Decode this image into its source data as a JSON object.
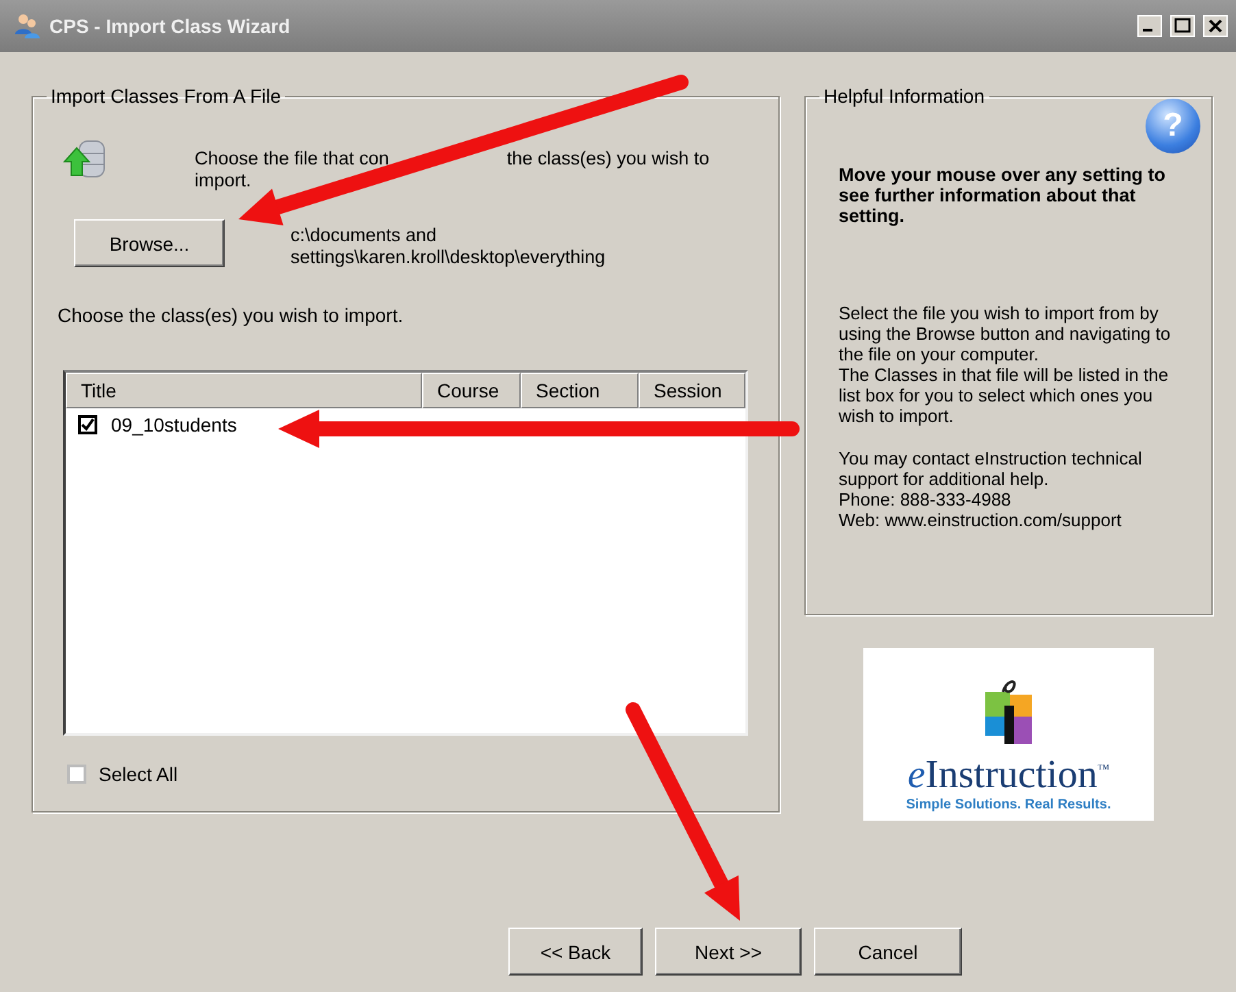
{
  "window": {
    "title": "CPS - Import Class Wizard"
  },
  "import_group": {
    "title": "Import Classes From A File",
    "instruction_parts": [
      "Choose the file that con",
      "the class(es) you wish to",
      "import."
    ],
    "browse_button": "Browse...",
    "file_path": "c:\\documents and settings\\karen.kroll\\desktop\\everything",
    "choose_label": "Choose the class(es) you wish to import.",
    "table": {
      "columns": [
        "Title",
        "Course",
        "Section",
        "Session"
      ],
      "rows": [
        {
          "title": "09_10students",
          "checked": true
        }
      ]
    },
    "select_all": {
      "label": "Select All",
      "checked": false
    }
  },
  "help_group": {
    "title": "Helpful Information",
    "icon_glyph": "?",
    "headline": "Move your mouse over any setting to see further information about that setting.",
    "paragraphs": [
      "Select the file you wish to import from by using the Browse button and navigating to the file on your computer.\nThe Classes in that file will be listed in the list box for you to select which ones you wish to import.",
      "You may contact eInstruction technical support for additional help.\nPhone: 888-333-4988\nWeb: www.einstruction.com/support"
    ]
  },
  "logo": {
    "wordmark_lead": "e",
    "wordmark": "Instruction",
    "trademark": "™",
    "tagline": "Simple Solutions. Real Results."
  },
  "buttons": [
    {
      "label": "<< Back"
    },
    {
      "label": "Next >>"
    },
    {
      "label": "Cancel"
    }
  ],
  "annotations": [
    {
      "kind": "arrow"
    },
    {
      "kind": "arrow"
    },
    {
      "kind": "arrow"
    }
  ]
}
